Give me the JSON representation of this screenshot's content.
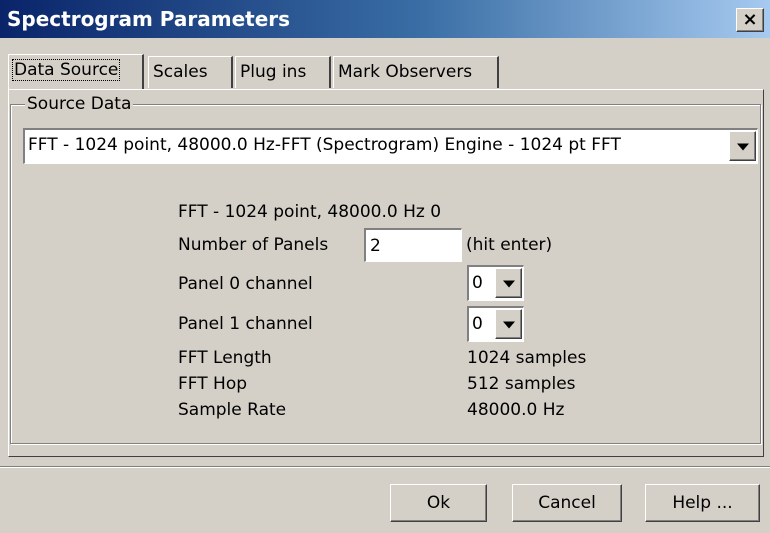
{
  "window": {
    "title": "Spectrogram Parameters",
    "close_label": "×"
  },
  "tabs": [
    {
      "label": "Data Source",
      "active": true
    },
    {
      "label": "Scales",
      "active": false
    },
    {
      "label": "Plug ins",
      "active": false
    },
    {
      "label": "Mark Observers",
      "active": false
    }
  ],
  "source_data": {
    "group_label": "Source Data",
    "selected_source": "FFT - 1024 point, 48000.0 Hz-FFT (Spectrogram) Engine - 1024 pt FFT",
    "heading": "FFT - 1024 point, 48000.0 Hz 0",
    "panels_label": "Number of Panels",
    "panels_value": "2",
    "panels_hint": "(hit enter)",
    "panel0_label": "Panel 0 channel",
    "panel0_value": "0",
    "panel1_label": "Panel 1 channel",
    "panel1_value": "0",
    "fft_length_label": "FFT Length",
    "fft_length_value": "1024 samples",
    "fft_hop_label": "FFT Hop",
    "fft_hop_value": "512 samples",
    "sample_rate_label": "Sample Rate",
    "sample_rate_value": "48000.0 Hz"
  },
  "buttons": {
    "ok": "Ok",
    "cancel": "Cancel",
    "help": "Help ..."
  },
  "colors": {
    "title_start": "#0a246a",
    "title_end": "#a6caf0",
    "face": "#d4d0c8"
  }
}
